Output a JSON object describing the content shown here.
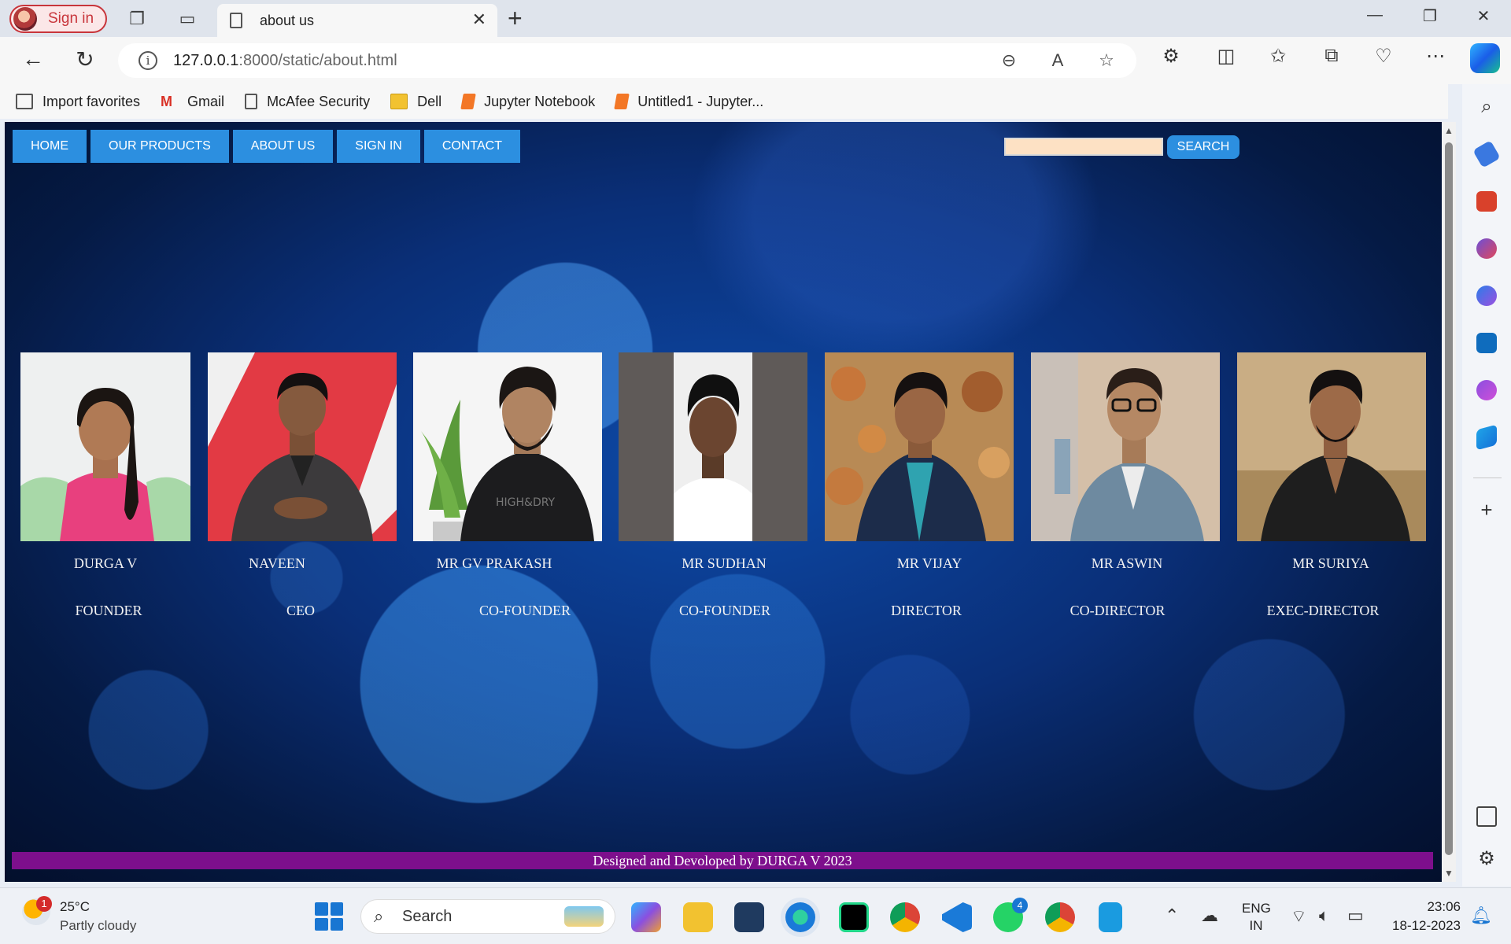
{
  "browser": {
    "profile_label": "Sign in",
    "tab_title": "about us",
    "url_host": "127.0.0.1",
    "url_rest": ":8000/static/about.html",
    "favorites": [
      {
        "label": "Import favorites",
        "icon": "import-icon",
        "color": "#555555"
      },
      {
        "label": "Gmail",
        "icon": "gmail-icon",
        "color": "#d93025"
      },
      {
        "label": "McAfee Security",
        "icon": "page-icon",
        "color": "#555555"
      },
      {
        "label": "Dell",
        "icon": "folder-icon",
        "color": "#f2c230"
      },
      {
        "label": "Jupyter Notebook",
        "icon": "jupyter-icon",
        "color": "#f37726"
      },
      {
        "label": "Untitled1 - Jupyter...",
        "icon": "jupyter-icon",
        "color": "#f37726"
      }
    ]
  },
  "page": {
    "nav": [
      "HOME",
      "OUR PRODUCTS",
      "ABOUT US",
      "SIGN IN",
      "CONTACT"
    ],
    "search_button": "SEARCH",
    "search_value": "",
    "team": [
      {
        "name": "DURGA V",
        "role": "FOUNDER"
      },
      {
        "name": "NAVEEN",
        "role": "CEO"
      },
      {
        "name": "MR GV PRAKASH",
        "role": "CO-FOUNDER"
      },
      {
        "name": "MR SUDHAN",
        "role": "CO-FOUNDER"
      },
      {
        "name": "MR VIJAY",
        "role": "DIRECTOR"
      },
      {
        "name": "MR ASWIN",
        "role": "CO-DIRECTOR"
      },
      {
        "name": "MR SURIYA",
        "role": "EXEC-DIRECTOR"
      }
    ],
    "footer": "Designed and Devoloped by DURGA V 2023",
    "colors": {
      "nav_button": "#2c8fe0",
      "footer_bar": "#7d0f8c",
      "search_input": "#fde1c4"
    }
  },
  "taskbar": {
    "weather_temp": "25°C",
    "weather_desc": "Partly cloudy",
    "weather_badge": "1",
    "search_label": "Search",
    "whatsapp_badge": "4",
    "lang_line1": "ENG",
    "lang_line2": "IN",
    "time": "23:06",
    "date": "18-12-2023"
  }
}
